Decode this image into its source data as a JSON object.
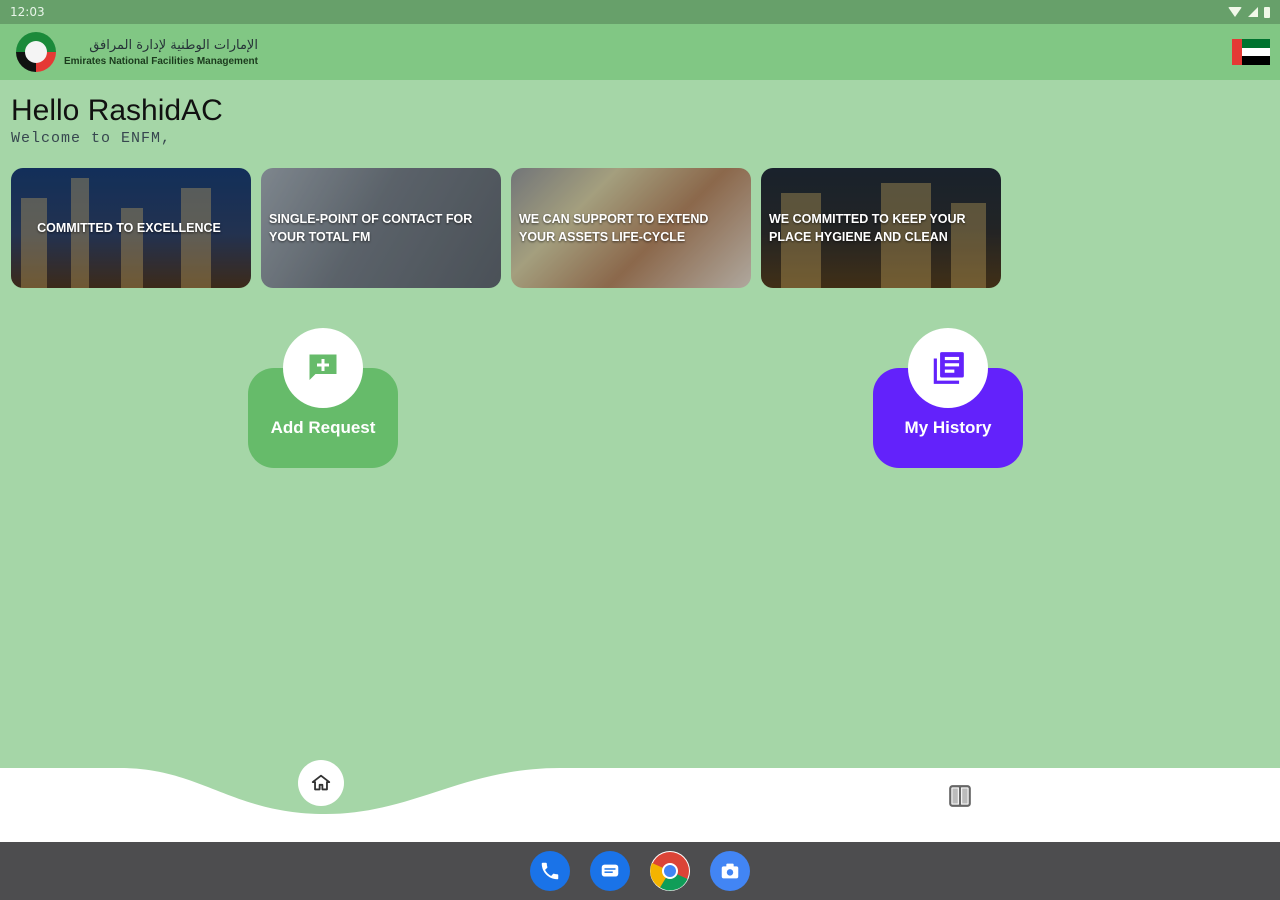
{
  "status_bar": {
    "time": "12:03"
  },
  "app_bar": {
    "brand_arabic": "الإمارات الوطنية لإدارة المرافق",
    "brand_english": "Emirates National Facilities Management",
    "logo_icon": "enfm-logo-icon",
    "flag_icon": "uae-flag-icon"
  },
  "header": {
    "greeting": "Hello RashidAC",
    "welcome": "Welcome to ENFM,"
  },
  "banners": [
    {
      "line1": "COMMITTED TO EXCELLENCE",
      "line2": ""
    },
    {
      "line1": "SINGLE-POINT OF CONTACT FOR",
      "line2": "YOUR TOTAL FM"
    },
    {
      "line1": "WE CAN SUPPORT TO EXTEND",
      "line2": "YOUR ASSETS LIFE-CYCLE"
    },
    {
      "line1": "WE COMMITTED TO KEEP YOUR",
      "line2": "PLACE HYGIENE AND CLEAN"
    }
  ],
  "actions": {
    "add_request": {
      "label": "Add Request",
      "icon": "add-comment-icon",
      "color": "#66bb6a"
    },
    "my_history": {
      "label": "My History",
      "icon": "library-books-icon",
      "color": "#6322fb"
    }
  },
  "bottom_nav": {
    "items": [
      {
        "icon": "home-icon",
        "active": true
      },
      {
        "icon": "book-icon",
        "active": false
      }
    ]
  },
  "dock": {
    "apps": [
      {
        "icon": "phone-icon",
        "color": "#1a73e8"
      },
      {
        "icon": "messages-icon",
        "color": "#1a73e8"
      },
      {
        "icon": "chrome-icon",
        "color": "#ffffff"
      },
      {
        "icon": "camera-icon",
        "color": "#4285f4"
      }
    ]
  },
  "colors": {
    "background": "#a5d6a7",
    "app_bar": "#81c784",
    "status_bar": "#67a06a",
    "system_nav": "#4d4d4f"
  }
}
